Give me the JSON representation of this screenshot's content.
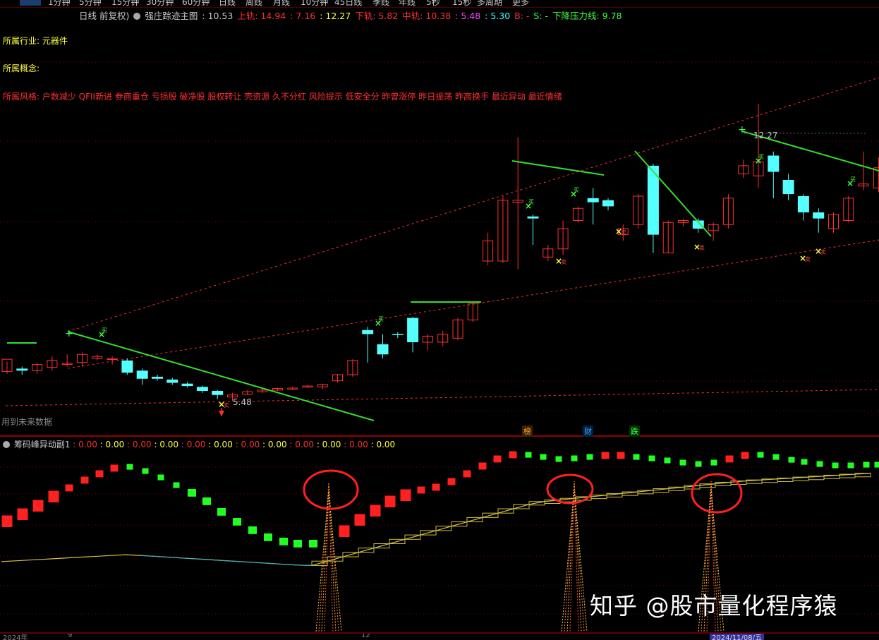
{
  "period_bar": {
    "items": [
      "1分钟",
      "5分钟",
      "15分钟",
      "30分钟",
      "60分钟",
      "日线",
      "周线",
      "月线",
      "10分钟",
      "45日线",
      "季线",
      "年线",
      "5秒",
      "15秒",
      "多周期",
      "更多"
    ]
  },
  "header": {
    "period": "日线 前复权)",
    "indicator": "强庄踪迹主图",
    "values": [
      {
        "label": "",
        "value": ": 10.53",
        "color": "#c8c8c8"
      },
      {
        "label": "上轨",
        "value": ": 14.94",
        "color": "#ff3030"
      },
      {
        "label": "",
        "value": ": 7.16",
        "color": "#ff3030"
      },
      {
        "label": "",
        "value": ": 12.27",
        "color": "#ffff40"
      },
      {
        "label": "下轨",
        "value": ": 5.82",
        "color": "#ff3030"
      },
      {
        "label": "中轨",
        "value": ": 10.38",
        "color": "#ff3030"
      },
      {
        "label": "",
        "value": ": 5.48",
        "color": "#ff40ff"
      },
      {
        "label": "",
        "value": ": 5.30",
        "color": "#40ffff"
      },
      {
        "label": "B",
        "value": ": -",
        "color": "#ff3030"
      },
      {
        "label": "S",
        "value": ": -",
        "color": "#40ff40"
      },
      {
        "label": "下降压力线",
        "value": ": 9.78",
        "color": "#40ff40"
      }
    ]
  },
  "info": {
    "industry_label": "所属行业:",
    "industry_value": "元器件",
    "concept_label": "所属概念:",
    "style_line": "所属风格: 户数减少 QFII新进 券商重仓 亏损股 破净股 股权转让 壳资源 久不分红 风险提示 低安全分 昨曾涨停 昨日振荡 昨高换手 最近异动 最近情绪"
  },
  "annotations": {
    "high_label": "12.27",
    "low_label": "5.48",
    "future_note": "用到未来数据",
    "buy_marker": "买",
    "sell_marker": "卖",
    "event_markers": [
      "榜",
      "财",
      "跌"
    ]
  },
  "sub_header": {
    "title": "筹码峰异动副1",
    "values": [
      ": 0.00",
      ": 0.00",
      ": 0.00",
      ": 0.00",
      ": 0.00",
      ": 0.00",
      ": 0.00",
      ": 0.00",
      ": 0.00",
      ": 0.00",
      ": 0.00",
      ": 0.00"
    ],
    "colors": [
      "#ff3030",
      "#ffff40",
      "#ff3030",
      "#ffff40",
      "#ff3030",
      "#ffff40",
      "#ff3030",
      "#ffff40",
      "#ff3030",
      "#ffff40",
      "#ff3030"
    ]
  },
  "bottom_dates": [
    "2024年",
    "9",
    "12",
    "2024/11/08/五"
  ],
  "watermark": "知乎 @股市量化程序猿",
  "colors": {
    "up": "#ff3030",
    "down": "#54ffff",
    "trend": "#30e030",
    "grid": "#800000",
    "text_yellow": "#ffff40"
  },
  "candles": [
    [
      5.68,
      5.98,
      5.62,
      5.92
    ],
    [
      5.75,
      5.7,
      5.6,
      5.8
    ],
    [
      5.7,
      5.85,
      5.62,
      5.9
    ],
    [
      5.78,
      5.95,
      5.7,
      6.05
    ],
    [
      5.85,
      5.88,
      5.8,
      6.1
    ],
    [
      5.9,
      6.1,
      5.8,
      6.15
    ],
    [
      6.0,
      6.05,
      5.95,
      6.1
    ],
    [
      5.98,
      6.0,
      5.85,
      6.05
    ],
    [
      5.95,
      5.65,
      5.6,
      6.0
    ],
    [
      5.7,
      5.5,
      5.35,
      5.75
    ],
    [
      5.55,
      5.5,
      5.45,
      5.6
    ],
    [
      5.48,
      5.4,
      5.35,
      5.52
    ],
    [
      5.38,
      5.32,
      5.28,
      5.42
    ],
    [
      5.3,
      5.2,
      5.15,
      5.33
    ],
    [
      5.2,
      5.1,
      5.0,
      5.22
    ],
    [
      5.05,
      5.1,
      4.95,
      5.15
    ],
    [
      5.12,
      5.18,
      5.1,
      5.22
    ],
    [
      5.18,
      5.22,
      5.15,
      5.25
    ],
    [
      5.22,
      5.26,
      5.2,
      5.28
    ],
    [
      5.25,
      5.27,
      5.22,
      5.3
    ],
    [
      5.3,
      5.32,
      5.28,
      5.35
    ],
    [
      5.3,
      5.36,
      5.25,
      5.38
    ],
    [
      5.45,
      5.6,
      5.4,
      5.62
    ],
    [
      5.6,
      5.95,
      5.55,
      5.98
    ],
    [
      6.7,
      6.6,
      5.9,
      6.78
    ],
    [
      6.35,
      6.1,
      6.0,
      6.6
    ],
    [
      6.6,
      6.58,
      6.5,
      6.65
    ],
    [
      7.0,
      6.4,
      6.15,
      7.02
    ],
    [
      6.4,
      6.55,
      6.2,
      6.6
    ],
    [
      6.4,
      6.6,
      6.3,
      6.68
    ],
    [
      6.5,
      6.95,
      6.45,
      7.0
    ],
    [
      6.95,
      7.35,
      6.9,
      7.4
    ],
    [
      8.4,
      8.9,
      8.3,
      9.1
    ],
    [
      8.4,
      9.9,
      8.35,
      10.0
    ],
    [
      9.85,
      9.9,
      8.2,
      11.45
    ],
    [
      9.5,
      9.45,
      8.8,
      9.55
    ],
    [
      8.5,
      8.7,
      8.4,
      8.8
    ],
    [
      8.7,
      9.2,
      8.55,
      9.4
    ],
    [
      9.4,
      9.7,
      9.35,
      9.75
    ],
    [
      9.95,
      9.85,
      9.3,
      10.2
    ],
    [
      9.9,
      9.75,
      9.65,
      9.95
    ],
    [
      9.05,
      9.2,
      8.9,
      9.3
    ],
    [
      9.3,
      10.0,
      9.2,
      10.05
    ],
    [
      10.75,
      9.05,
      8.6,
      10.8
    ],
    [
      8.6,
      9.35,
      8.6,
      9.4
    ],
    [
      9.35,
      9.4,
      9.25,
      9.45
    ],
    [
      9.4,
      9.2,
      9.1,
      9.45
    ],
    [
      9.15,
      9.3,
      8.9,
      9.35
    ],
    [
      9.3,
      9.95,
      9.2,
      10.05
    ],
    [
      10.55,
      10.75,
      10.45,
      10.9
    ],
    [
      10.5,
      10.85,
      10.2,
      12.27
    ],
    [
      11.0,
      10.6,
      9.95,
      11.1
    ],
    [
      10.4,
      10.05,
      9.9,
      10.55
    ],
    [
      10.0,
      9.6,
      9.4,
      10.05
    ],
    [
      9.6,
      9.45,
      9.1,
      9.7
    ],
    [
      9.2,
      9.55,
      9.1,
      9.6
    ],
    [
      9.4,
      9.95,
      9.35,
      10.0
    ],
    [
      10.25,
      10.3,
      10.15,
      11.1
    ],
    [
      10.2,
      10.7,
      10.1,
      10.95
    ],
    [
      10.3,
      10.35,
      10.0,
      10.4
    ],
    [
      10.4,
      10.48,
      10.3,
      10.5
    ],
    [
      10.4,
      10.53,
      10.35,
      10.55
    ]
  ]
}
